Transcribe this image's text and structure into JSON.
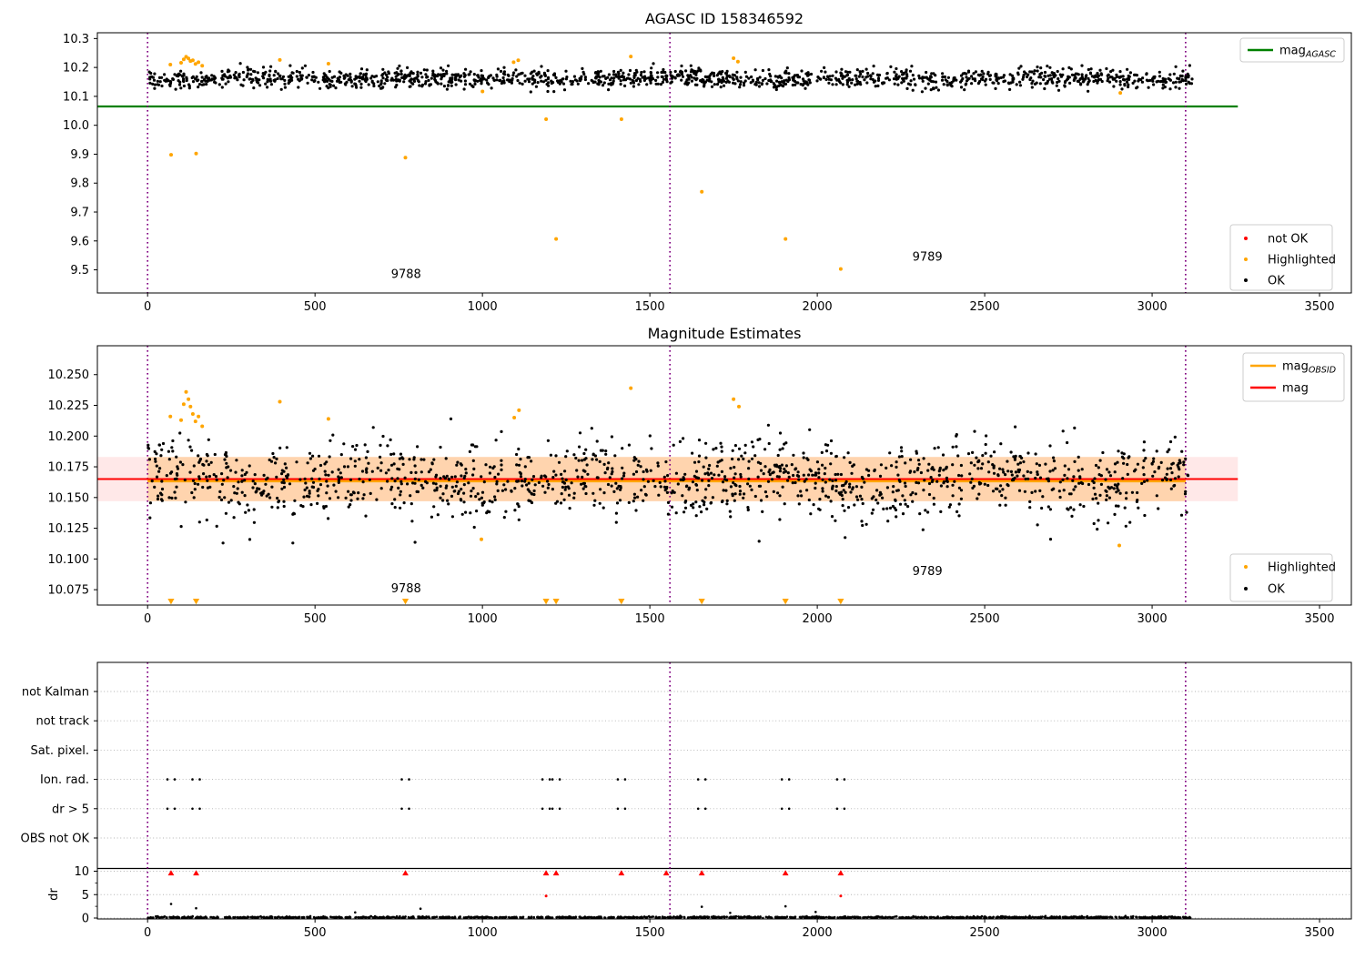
{
  "figure": {
    "background": "#ffffff"
  },
  "colors": {
    "ok": "#000000",
    "not_ok": "#ff0000",
    "highlighted": "#ffa500",
    "mag_agasc_line": "#008000",
    "mag_line": "#ff0000",
    "mag_obsid_line": "#ffa500",
    "obsid_boundary": "#800080",
    "grid_gray": "#b3b3b3",
    "legend_border": "#cccccc",
    "pink_band": "rgba(255,0,0,0.09)",
    "orange_band": "rgba(255,150,0,0.25)"
  },
  "chart_data": [
    {
      "type": "scatter",
      "title": "AGASC ID 158346592",
      "xlim": [
        -150,
        3595
      ],
      "ylim": [
        9.42,
        10.32
      ],
      "xticks": [
        0,
        500,
        1000,
        1500,
        2000,
        2500,
        3000,
        3500
      ],
      "yticks": [
        10.3,
        10.2,
        10.1,
        10.0,
        9.9,
        9.8,
        9.7,
        9.6,
        9.5
      ],
      "ytick_labels": [
        "10.3",
        "10.2",
        "10.1",
        "10.0",
        "9.9",
        "9.8",
        "9.7",
        "9.6",
        "9.5"
      ],
      "mag_agasc": 10.065,
      "agasc_line_extent": [
        -150,
        3256
      ],
      "obsid_boundaries": [
        0,
        1560,
        3100
      ],
      "annotations": [
        {
          "text": "9788",
          "x": 772,
          "y": 9.472
        },
        {
          "text": "9789",
          "x": 2329,
          "y": 9.531
        }
      ],
      "ok_scatter": {
        "n": 1500,
        "x_min": 0,
        "x_max": 3120,
        "y_mean": 10.162,
        "y_std": 0.016,
        "y_min": 10.096,
        "y_max": 10.226,
        "seed": 42
      },
      "highlighted": [
        [
          68,
          10.21
        ],
        [
          100,
          10.216
        ],
        [
          108,
          10.228
        ],
        [
          115,
          10.237
        ],
        [
          122,
          10.231
        ],
        [
          128,
          10.222
        ],
        [
          135,
          10.225
        ],
        [
          143,
          10.212
        ],
        [
          152,
          10.218
        ],
        [
          163,
          10.206
        ],
        [
          395,
          10.226
        ],
        [
          540,
          10.213
        ],
        [
          1000,
          10.117
        ],
        [
          1093,
          10.218
        ],
        [
          1107,
          10.225
        ],
        [
          1443,
          10.238
        ],
        [
          1750,
          10.232
        ],
        [
          1763,
          10.22
        ],
        [
          2905,
          10.112
        ],
        [
          70,
          9.898
        ],
        [
          145,
          9.902
        ],
        [
          770,
          9.888
        ],
        [
          1190,
          10.021
        ],
        [
          1220,
          9.607
        ],
        [
          1415,
          10.021
        ],
        [
          1655,
          9.77
        ],
        [
          1905,
          9.607
        ],
        [
          2070,
          9.503
        ]
      ],
      "legend_lines": [
        {
          "main": "mag",
          "sub": "AGASC",
          "color": "#008000"
        }
      ],
      "legend_markers": [
        {
          "label": "not OK",
          "color": "#ff0000"
        },
        {
          "label": "Highlighted",
          "color": "#ffa500"
        },
        {
          "label": "OK",
          "color": "#000000"
        }
      ]
    },
    {
      "type": "scatter",
      "title": "Magnitude Estimates",
      "xlim": [
        -150,
        3595
      ],
      "ylim": [
        10.0625,
        10.2735
      ],
      "xticks": [
        0,
        500,
        1000,
        1500,
        2000,
        2500,
        3000,
        3500
      ],
      "yticks": [
        10.25,
        10.225,
        10.2,
        10.175,
        10.15,
        10.125,
        10.1,
        10.075
      ],
      "ytick_labels": [
        "10.250",
        "10.225",
        "10.200",
        "10.175",
        "10.150",
        "10.125",
        "10.100",
        "10.075"
      ],
      "mag": 10.165,
      "mag_band": [
        10.147,
        10.183
      ],
      "mag_line_extent": [
        -150,
        3256
      ],
      "mag_obsid": 10.1635,
      "obsid_line_extent": [
        0,
        3100
      ],
      "obsid_boundaries": [
        0,
        1560,
        3100
      ],
      "annotations": [
        {
          "text": "9788",
          "x": 772,
          "y": 10.073
        },
        {
          "text": "9789",
          "x": 2329,
          "y": 10.087
        }
      ],
      "ok_scatter": {
        "n": 1400,
        "x_min": 0,
        "x_max": 3120,
        "y_mean": 10.165,
        "y_std": 0.016,
        "y_min": 10.113,
        "y_max": 10.214,
        "seed": 7
      },
      "highlighted": [
        [
          68,
          10.216
        ],
        [
          100,
          10.213
        ],
        [
          108,
          10.226
        ],
        [
          115,
          10.236
        ],
        [
          122,
          10.23
        ],
        [
          128,
          10.224
        ],
        [
          135,
          10.218
        ],
        [
          143,
          10.212
        ],
        [
          152,
          10.216
        ],
        [
          163,
          10.208
        ],
        [
          395,
          10.228
        ],
        [
          540,
          10.214
        ],
        [
          997,
          10.116
        ],
        [
          1095,
          10.215
        ],
        [
          1109,
          10.221
        ],
        [
          1443,
          10.239
        ],
        [
          1750,
          10.23
        ],
        [
          1766,
          10.224
        ],
        [
          2902,
          10.111
        ]
      ],
      "clipped_low_x": [
        70,
        145,
        770,
        1190,
        1220,
        1415,
        1655,
        1905,
        2070
      ],
      "legend_lines": [
        {
          "main": "mag",
          "sub": "OBSID",
          "color": "#ffa500"
        },
        {
          "main": "mag",
          "sub": "",
          "color": "#ff0000"
        }
      ],
      "legend_markers": [
        {
          "label": "Highlighted",
          "color": "#ffa500"
        },
        {
          "label": "OK",
          "color": "#000000"
        }
      ]
    },
    {
      "type": "flags",
      "rows": [
        "not Kalman",
        "not track",
        "Sat. pixel.",
        "Ion. rad.",
        "dr > 5",
        "OBS not OK"
      ],
      "dr_axis": {
        "label": "dr",
        "ticks": [
          0,
          5,
          10
        ]
      },
      "xticks": [
        0,
        500,
        1000,
        1500,
        2000,
        2500,
        3000,
        3500
      ],
      "obsid_boundaries": [
        0,
        1560,
        3100
      ],
      "flag_events": {
        "ion_rad": [
          70,
          145,
          770,
          1190,
          1220,
          1415,
          1655,
          1905,
          2070
        ],
        "dr_gt_5": [
          70,
          145,
          770,
          1190,
          1220,
          1415,
          1655,
          1905,
          2070
        ]
      },
      "not_ok_clipped_x": [
        70,
        145,
        770,
        1190,
        1220,
        1415,
        1549,
        1655,
        1905,
        2070
      ],
      "not_ok_points": [
        [
          1190,
          4.7
        ],
        [
          2070,
          4.7
        ]
      ],
      "dr_spikes": [
        [
          70,
          3.0
        ],
        [
          145,
          2.1
        ],
        [
          815,
          2.0
        ],
        [
          1655,
          2.4
        ],
        [
          1905,
          2.5
        ],
        [
          620,
          1.2
        ],
        [
          1740,
          1.1
        ],
        [
          1995,
          1.3
        ]
      ],
      "dr_band": {
        "n": 1400,
        "x_min": 0,
        "x_max": 3120,
        "y_mean": 0.15,
        "y_std": 0.11,
        "y_min": 0.02,
        "y_max": 1.1,
        "seed": 13
      }
    }
  ]
}
